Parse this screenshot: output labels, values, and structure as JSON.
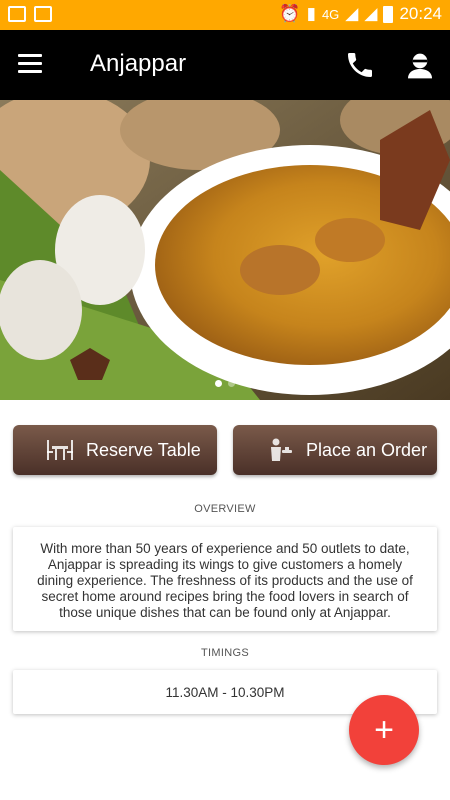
{
  "status_bar": {
    "network": "4G",
    "time": "20:24",
    "icons": [
      "gallery-icon",
      "mail-icon",
      "alarm-icon",
      "sim-icon",
      "signal-icon",
      "signal-icon",
      "battery-icon"
    ]
  },
  "app_bar": {
    "title": "Anjappar",
    "menu_icon": "menu-icon",
    "call_icon": "phone-icon",
    "account_icon": "account-icon"
  },
  "hero": {
    "image_alt": "Chicken curry dish in a white bowl with garlic and ginger",
    "slides": 2,
    "active_slide": 1
  },
  "actions": {
    "reserve_label": "Reserve Table",
    "order_label": "Place an Order"
  },
  "overview": {
    "heading": "OVERVIEW",
    "text": "With more than 50 years of experience and 50 outlets to date, Anjappar is spreading its wings to give customers a homely dining experience. The freshness of its products and the use of secret home around recipes bring the food lovers in search of those unique dishes that can be found only at Anjappar."
  },
  "timings": {
    "heading": "TIMINGS",
    "value": "11.30AM - 10.30PM"
  },
  "fab": {
    "label": "+",
    "color": "#F2413A"
  },
  "colors": {
    "status_bar": "#FFA800",
    "app_bar": "#000000",
    "button_brown": "#5a3e34"
  }
}
